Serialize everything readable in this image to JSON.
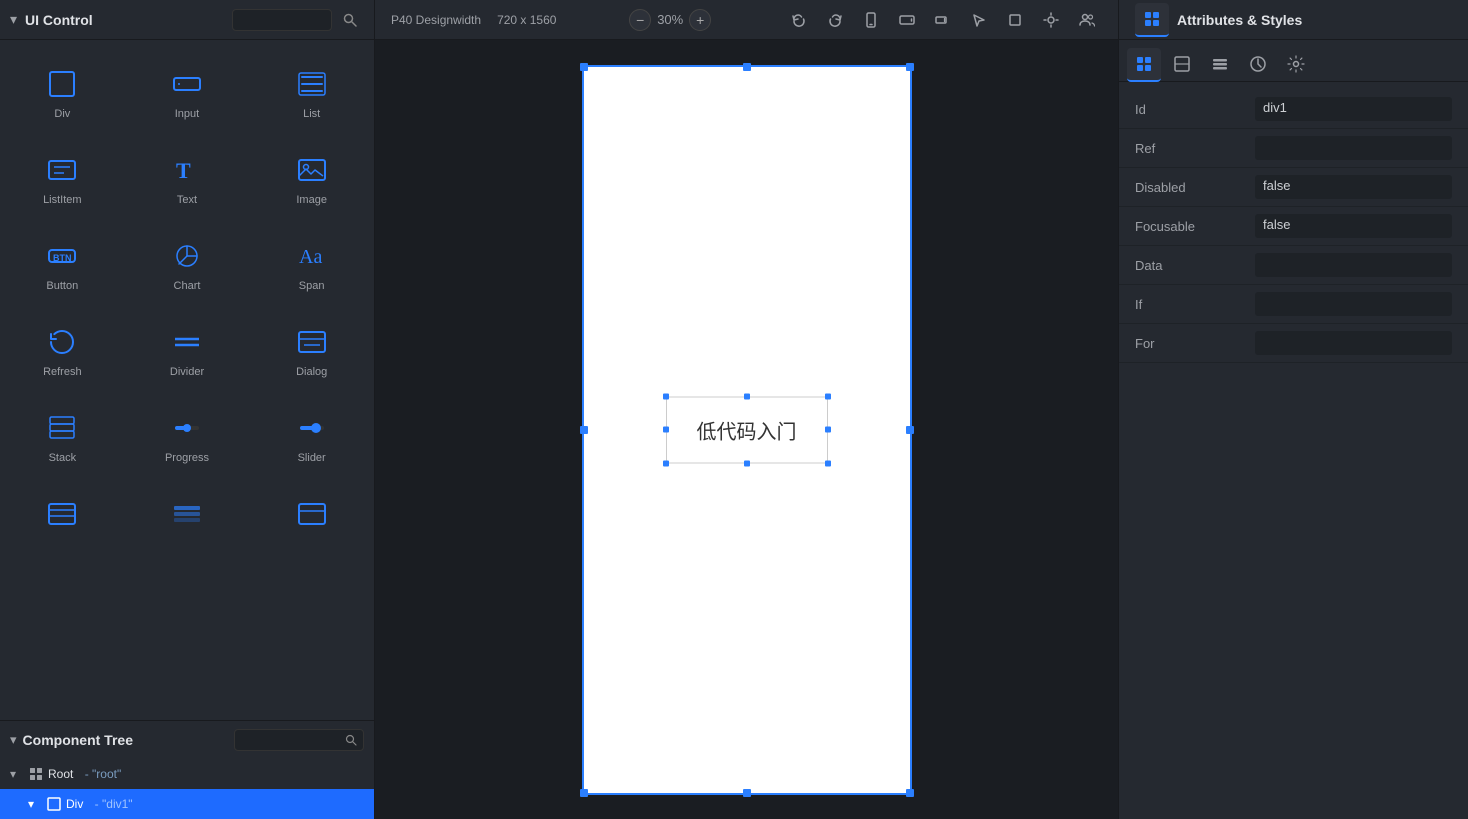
{
  "topBar": {
    "title": "UI Control",
    "designWidth": "P40 Designwidth",
    "resolution": "720 x 1560",
    "zoom": "30%",
    "attrsTitle": "Attributes & Styles"
  },
  "leftPanel": {
    "components": [
      {
        "id": "div",
        "label": "Div"
      },
      {
        "id": "input",
        "label": "Input"
      },
      {
        "id": "list",
        "label": "List"
      },
      {
        "id": "listitem",
        "label": "ListItem"
      },
      {
        "id": "text",
        "label": "Text"
      },
      {
        "id": "image",
        "label": "Image"
      },
      {
        "id": "button",
        "label": "Button"
      },
      {
        "id": "chart",
        "label": "Chart"
      },
      {
        "id": "span",
        "label": "Span"
      },
      {
        "id": "refresh",
        "label": "Refresh"
      },
      {
        "id": "divider",
        "label": "Divider"
      },
      {
        "id": "dialog",
        "label": "Dialog"
      },
      {
        "id": "stack",
        "label": "Stack"
      },
      {
        "id": "progress",
        "label": "Progress"
      },
      {
        "id": "slider",
        "label": "Slider"
      }
    ]
  },
  "componentTree": {
    "title": "Component Tree",
    "searchPlaceholder": "",
    "nodes": [
      {
        "id": "root-node",
        "name": "Root",
        "nodeId": "- \"root\"",
        "level": 0,
        "hasChevron": true,
        "selected": false
      },
      {
        "id": "div1-node",
        "name": "Div",
        "nodeId": "- \"div1\"",
        "level": 1,
        "hasChevron": true,
        "selected": true
      }
    ]
  },
  "canvas": {
    "contentText": "低代码入门"
  },
  "rightPanel": {
    "tabs": [
      {
        "id": "properties",
        "label": "Properties",
        "active": true
      },
      {
        "id": "layout",
        "label": "Layout"
      },
      {
        "id": "style",
        "label": "Style"
      },
      {
        "id": "events",
        "label": "Events"
      },
      {
        "id": "settings",
        "label": "Settings"
      }
    ],
    "properties": [
      {
        "label": "Id",
        "value": "div1"
      },
      {
        "label": "Ref",
        "value": ""
      },
      {
        "label": "Disabled",
        "value": "false"
      },
      {
        "label": "Focusable",
        "value": "false"
      },
      {
        "label": "Data",
        "value": ""
      },
      {
        "label": "If",
        "value": ""
      },
      {
        "label": "For",
        "value": ""
      }
    ]
  }
}
